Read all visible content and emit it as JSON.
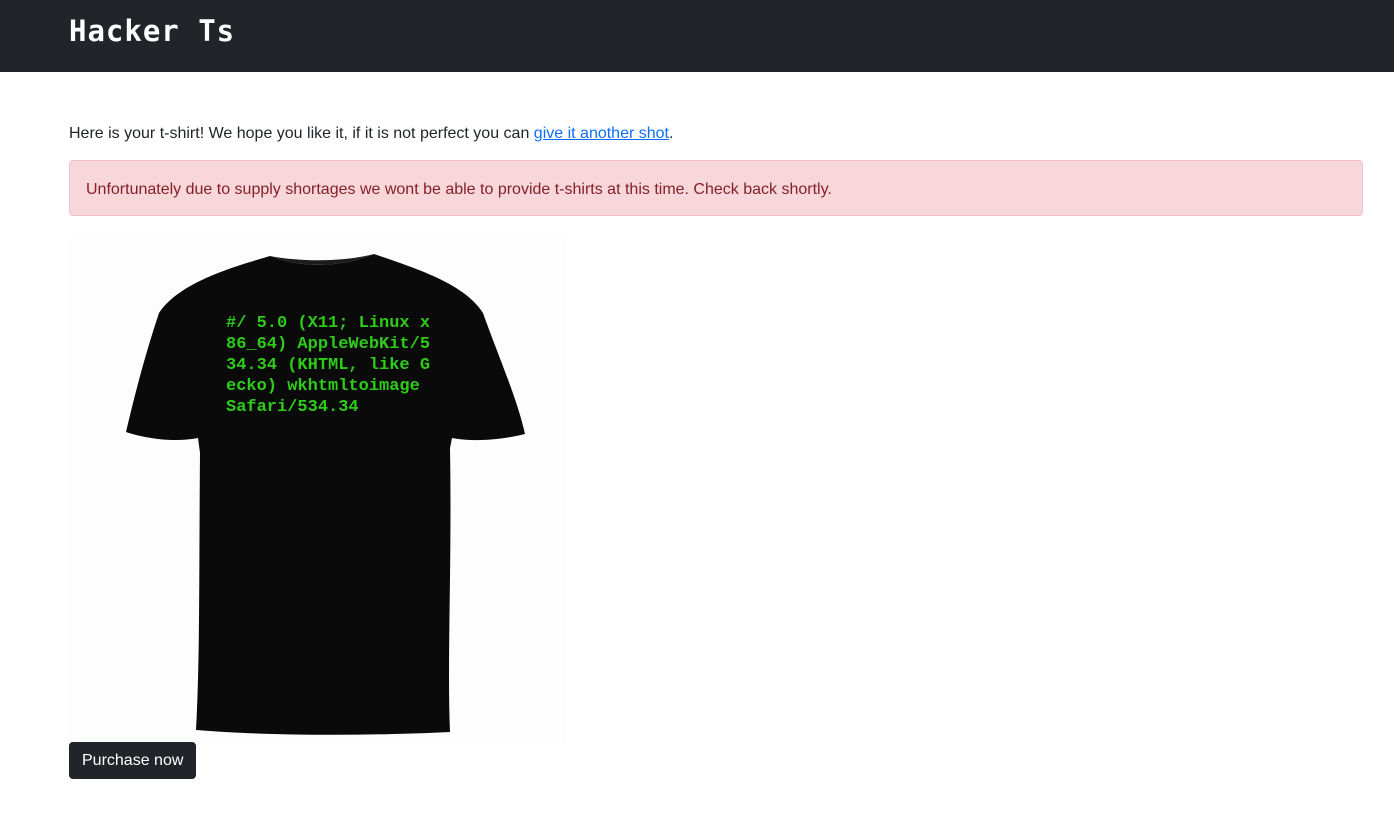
{
  "navbar": {
    "brand": "Hacker Ts"
  },
  "intro": {
    "text_before": "Here is your t-shirt! We hope you like it, if it is not perfect you can ",
    "link_text": "give it another shot",
    "text_after": "."
  },
  "alert": {
    "message": "Unfortunately due to supply shortages we wont be able to provide t-shirts at this time. Check back shortly."
  },
  "tshirt": {
    "print_text": "#/ 5.0 (X11; Linux x86_64) AppleWebKit/534.34 (KHTML, like Gecko) wkhtmltoimage Safari/534.34",
    "shirt_color": "#0a0a0a",
    "print_color": "#2ecc1a"
  },
  "actions": {
    "purchase_label": "Purchase now"
  },
  "colors": {
    "navbar_bg": "#212529",
    "alert_bg": "#f8d7da",
    "alert_text": "#842029",
    "link": "#0d6efd",
    "button_bg": "#212529"
  }
}
